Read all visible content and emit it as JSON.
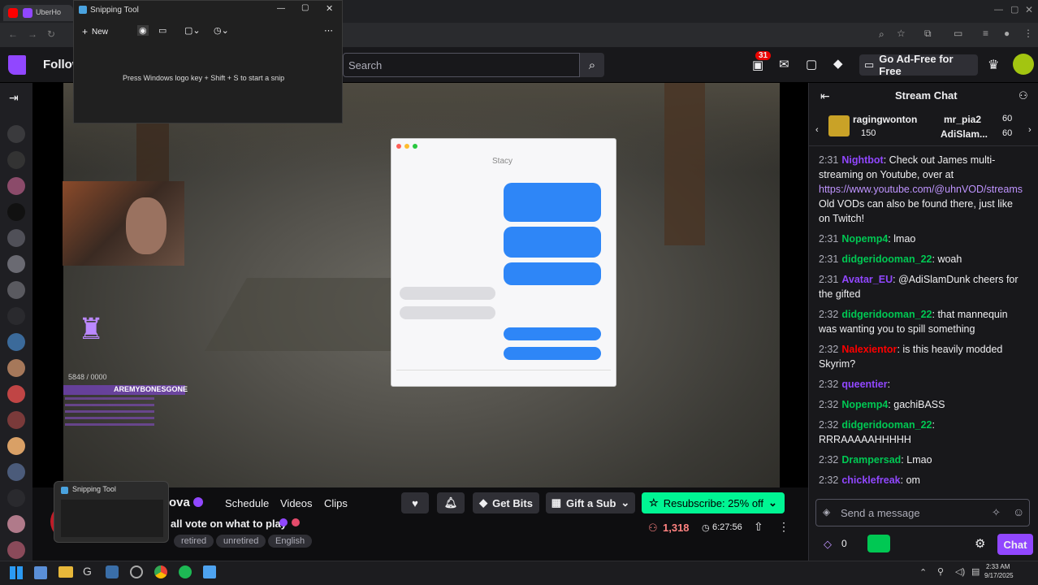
{
  "browser": {
    "tab_label": "UberHo"
  },
  "snip": {
    "title": "Snipping Tool",
    "new_label": "New",
    "hint": "Press Windows logo key + Shift + S to start a snip",
    "taskbar_preview_title": "Snipping Tool"
  },
  "twitch": {
    "following": "Follow",
    "search_placeholder": "Search",
    "notif_count": "31",
    "ad_free": "Go Ad-Free for Free"
  },
  "stream": {
    "channel_tail": "ova",
    "nav": [
      "Schedule",
      "Videos",
      "Clips"
    ],
    "title_tail": "all vote on what to play",
    "tags": [
      "retired",
      "unretired",
      "English"
    ],
    "get_bits": "Get Bits",
    "gift_sub": "Gift a Sub",
    "resub": "Resubscribe: 25% off",
    "viewers": "1,318",
    "uptime": "6:27:56"
  },
  "overlay": {
    "counter": "5848 / 0000",
    "top_user": "AREMYBONESGONE",
    "text_window_title": "Stacy"
  },
  "chat": {
    "header": "Stream Chat",
    "gifters": [
      {
        "name": "ragingwonton",
        "count": "150"
      },
      {
        "name": "mr_pia2",
        "count": "60"
      },
      {
        "name": "AdiSlam...",
        "count": "60"
      }
    ],
    "messages": [
      {
        "time": "2:31",
        "user": "Nightbot",
        "color": "#9147ff",
        "text": "Check out James multi-streaming on Youtube, over at "
      },
      {
        "time": "2:31",
        "user": "Nopemp4",
        "color": "#00c853",
        "text": "lmao"
      },
      {
        "time": "2:31",
        "user": "didgeridooman_22",
        "color": "#00c853",
        "text": "woah"
      },
      {
        "time": "2:31",
        "user": "Avatar_EU",
        "color": "#9147ff",
        "text": "@AdiSlamDunk cheers for the gifted"
      },
      {
        "time": "2:32",
        "user": "didgeridooman_22",
        "color": "#00c853",
        "text": "that mannequin was wanting you to spill something"
      },
      {
        "time": "2:32",
        "user": "Nalexientor",
        "color": "#ff0000",
        "text": "is this heavily modded Skyrim?"
      },
      {
        "time": "2:32",
        "user": "queentier",
        "color": "#9147ff",
        "text": ""
      },
      {
        "time": "2:32",
        "user": "Nopemp4",
        "color": "#00c853",
        "text": "gachiBASS"
      },
      {
        "time": "2:32",
        "user": "didgeridooman_22",
        "color": "#00c853",
        "text": "RRRAAAAAHHHHH"
      },
      {
        "time": "2:32",
        "user": "Drampersad",
        "color": "#00c853",
        "text": "Lmao"
      },
      {
        "time": "2:32",
        "user": "chicklefreak",
        "color": "#9147ff",
        "text": "om"
      }
    ],
    "link": "https://www.youtube.com/@uhnVOD/streams",
    "link_suffix": "Old VODs can also be found there, just like on Twitch!",
    "send_placeholder": "Send a message",
    "points": "0",
    "chat_btn": "Chat"
  },
  "taskbar": {
    "time": "2:33 AM",
    "date": "9/17/2025"
  },
  "colors": {
    "twitch_purple": "#9147ff",
    "resub_green": "#00f593",
    "chat_bg": "#18181b"
  }
}
